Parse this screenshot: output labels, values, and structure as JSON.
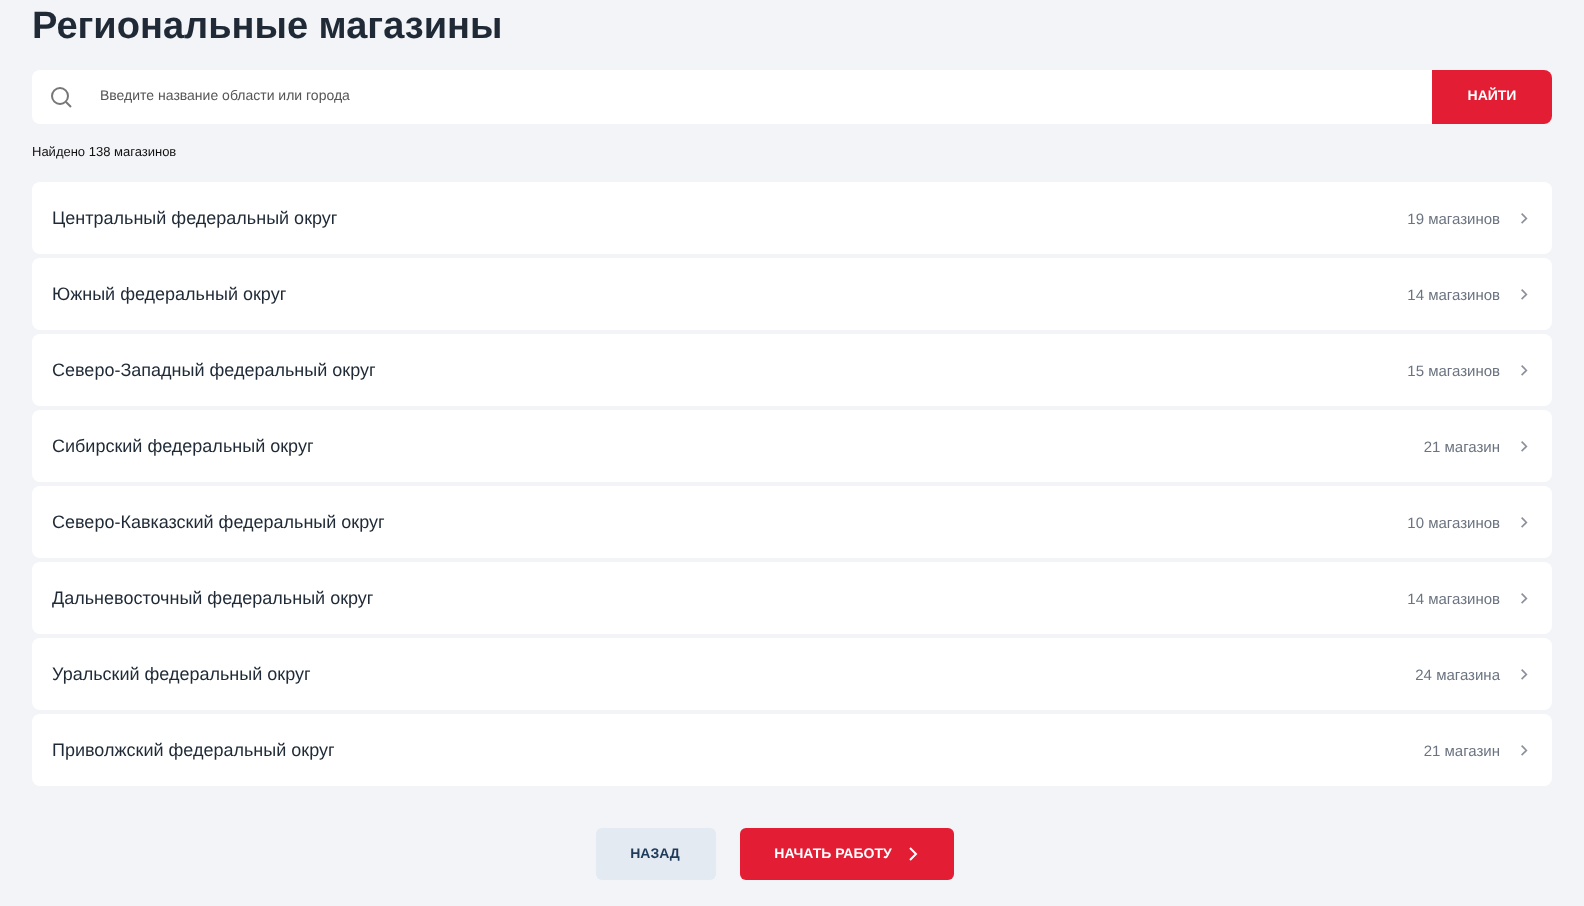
{
  "title": "Региональные магазины",
  "search": {
    "placeholder": "Введите название области или города",
    "button": "НАЙТИ"
  },
  "found": "Найдено 138 магазинов",
  "regions": [
    {
      "name": "Центральный федеральный округ",
      "count": "19 магазинов"
    },
    {
      "name": "Южный федеральный округ",
      "count": "14 магазинов"
    },
    {
      "name": "Северо-Западный федеральный округ",
      "count": "15 магазинов"
    },
    {
      "name": "Сибирский федеральный округ",
      "count": "21 магазин"
    },
    {
      "name": "Северо-Кавказский федеральный округ",
      "count": "10 магазинов"
    },
    {
      "name": "Дальневосточный федеральный округ",
      "count": "14 магазинов"
    },
    {
      "name": "Уральский федеральный округ",
      "count": "24 магазина"
    },
    {
      "name": "Приволжский федеральный округ",
      "count": "21 магазин"
    }
  ],
  "buttons": {
    "back": "НАЗАД",
    "start": "НАЧАТЬ РАБОТУ"
  }
}
